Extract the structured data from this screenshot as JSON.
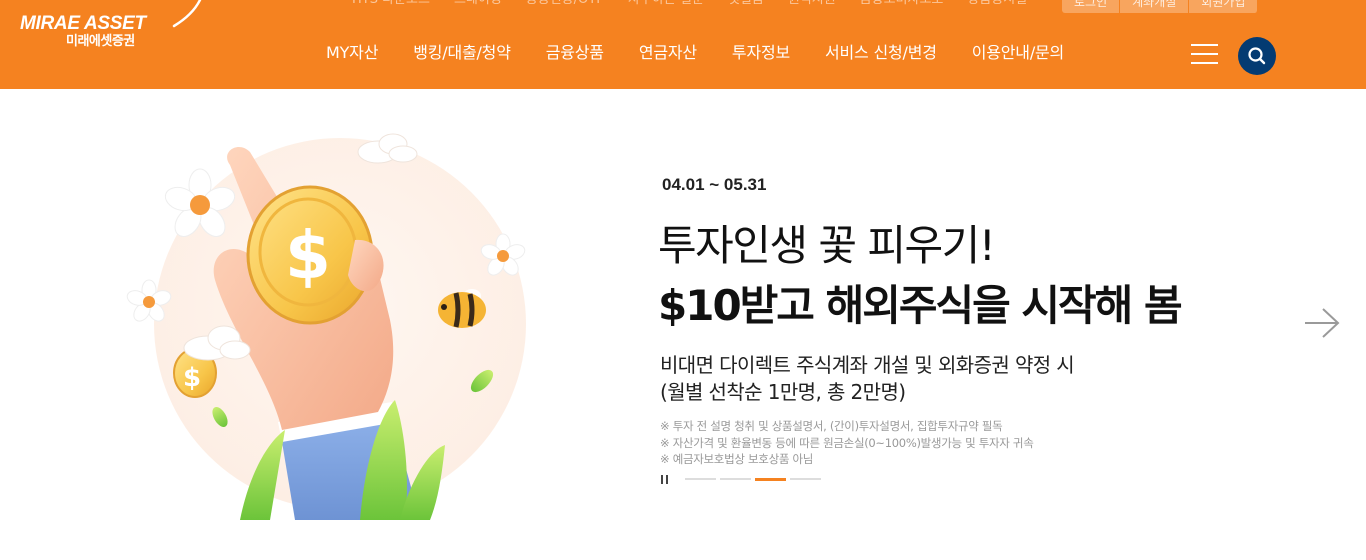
{
  "brand": {
    "logo_en": "MIRAE ASSET",
    "logo_ko": "미래에셋증권",
    "primary_color": "#f58220",
    "navy_color": "#043b72"
  },
  "utility": {
    "links": [
      "HTS 다운로드",
      "트레이딩",
      "공공인증/OTP",
      "자주하는 질문",
      "첫걸음",
      "원격지원",
      "금융소비자보호",
      "상품공시실"
    ],
    "buttons": [
      "로그인",
      "계좌개설",
      "회원가입"
    ]
  },
  "gnb": {
    "items": [
      "MY자산",
      "뱅킹/대출/청약",
      "금융상품",
      "연금자산",
      "투자정보",
      "서비스 신청/변경",
      "이용안내/문의"
    ],
    "menu_icon": "hamburger-icon",
    "search_icon": "search-icon"
  },
  "hero": {
    "period": "04.01 ~ 05.31",
    "title_line1": "투자인생 꽃 피우기!",
    "title_line2": "$10받고 해외주식을 시작해 봄",
    "desc_line1": "비대면 다이렉트 주식계좌 개설 및 외화증권 약정 시",
    "desc_line2": "(월별 선착순 1만명, 총 2만명)",
    "notices": [
      "※ 투자 전 설명 청취 및 상품설명서, (간이)투자설명서, 집합투자규약 필독",
      "※ 자산가격 및 환율변동 등에 따른 원금손실(0~100%)발생가능 및 투자자 귀속",
      "※ 예금자보호법상 보호상품 아님"
    ],
    "pagination_count": 4,
    "active_slide_index": 2,
    "next_icon": "arrow-right-icon",
    "pause_icon": "pause-icon"
  }
}
